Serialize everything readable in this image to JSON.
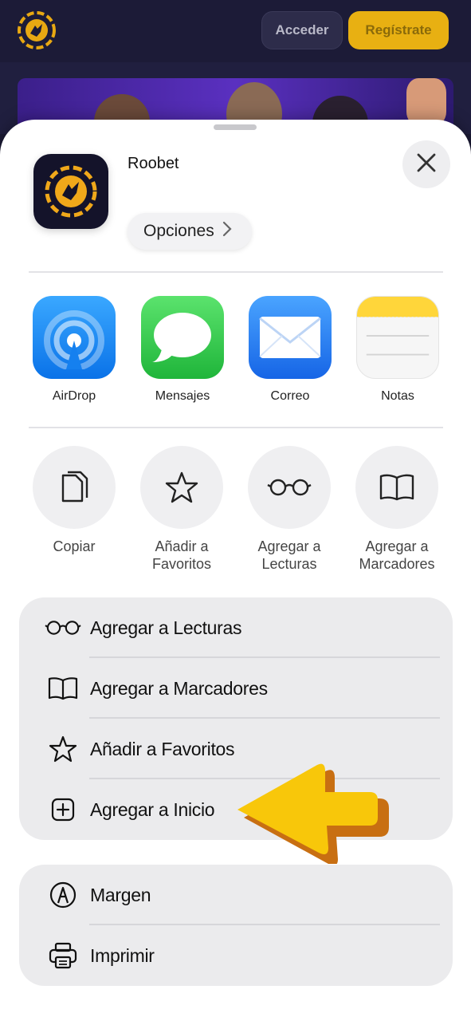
{
  "site": {
    "login_label": "Acceder",
    "register_label": "Regístrate"
  },
  "sheet": {
    "app_name": "Roobet",
    "options_label": "Opciones",
    "share_apps": [
      {
        "label": "AirDrop",
        "icon": "airdrop-icon"
      },
      {
        "label": "Mensajes",
        "icon": "messages-icon"
      },
      {
        "label": "Correo",
        "icon": "mail-icon"
      },
      {
        "label": "Notas",
        "icon": "notes-icon"
      }
    ],
    "quick_actions": [
      {
        "label_1": "Copiar",
        "label_2": "",
        "icon": "copy-icon"
      },
      {
        "label_1": "Añadir a",
        "label_2": "Favoritos",
        "icon": "star-icon"
      },
      {
        "label_1": "Agregar a",
        "label_2": "Lecturas",
        "icon": "glasses-icon"
      },
      {
        "label_1": "Agregar a",
        "label_2": "Marcadores",
        "icon": "book-icon"
      }
    ],
    "menu_group_1": [
      {
        "label": "Agregar a Lecturas",
        "icon": "glasses-icon"
      },
      {
        "label": "Agregar a Marcadores",
        "icon": "book-icon"
      },
      {
        "label": "Añadir a Favoritos",
        "icon": "star-icon"
      },
      {
        "label": "Agregar a Inicio",
        "icon": "plus-square-icon"
      }
    ],
    "menu_group_2": [
      {
        "label": "Margen",
        "icon": "markup-icon"
      },
      {
        "label": "Imprimir",
        "icon": "printer-icon"
      }
    ]
  },
  "colors": {
    "accent_yellow": "#f8c70a",
    "arrow_outline": "#c86f12",
    "airdrop_blue": "#1a8cf8",
    "messages_green": "#2fc84a",
    "mail_blue": "#2a86f5"
  }
}
